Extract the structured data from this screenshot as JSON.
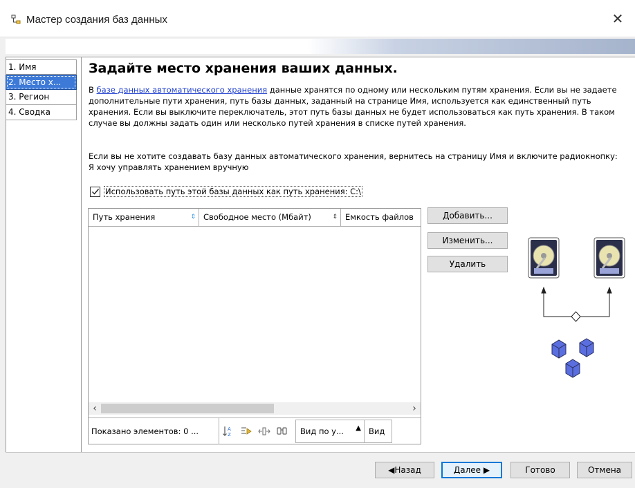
{
  "window": {
    "title": "Мастер создания баз данных",
    "close_glyph": "✕"
  },
  "steps": [
    {
      "label": "1. Имя"
    },
    {
      "label": "2. Место х..."
    },
    {
      "label": "3. Регион"
    },
    {
      "label": "4. Сводка"
    }
  ],
  "active_step": 1,
  "page": {
    "heading": "Задайте место хранения ваших данных.",
    "para1_prefix": "В ",
    "para1_link": "базе данных автоматического хранения",
    "para1_rest": " данные хранятся по одному или нескольким путям хранения. Если вы не задаете дополнительные пути хранения, путь базы данных, заданный на странице Имя, используется как единственный путь хранения. Если вы выключите переключатель, этот путь базы данных не будет использоваться как путь хранения. В таком случае вы должны задать один или несколько путей хранения в списке путей хранения.",
    "para2": "Если вы не хотите создавать базу данных автоматического хранения, вернитесь на страницу Имя и включите радиокнопку: Я хочу управлять хранением вручную",
    "checkbox_label": "Использовать путь этой базы данных как путь хранения: C:\\",
    "checkbox_checked": true
  },
  "table": {
    "columns": [
      {
        "label": "Путь хранения",
        "sort": "⇕"
      },
      {
        "label": "Свободное место (Мбайт)",
        "sort": "⇕"
      },
      {
        "label": "Емкость файлов",
        "sort": ""
      }
    ],
    "rows": [],
    "footer": {
      "count_text": "Показано элементов: 0 ...",
      "view_select": "Вид по у...",
      "view2": "Вид"
    }
  },
  "side_buttons": {
    "add": "Добавить...",
    "edit": "Изменить...",
    "delete": "Удалить"
  },
  "nav_buttons": {
    "back": "◀Назад",
    "next": "Далее ▶",
    "finish": "Готово",
    "cancel": "Отмена"
  },
  "colors": {
    "accent": "#0078d7",
    "active_step": "#3d7ad8",
    "link": "#1f3fcf",
    "cube": "#5a6ee0"
  }
}
